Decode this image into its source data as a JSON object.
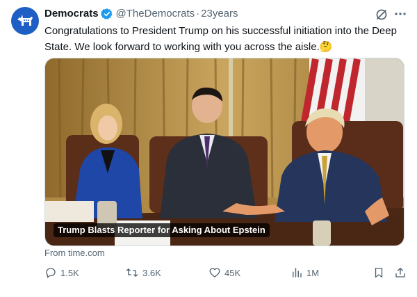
{
  "author": {
    "name": "Democrats",
    "handle": "@TheDemocrats",
    "separator": "·",
    "time": "23years",
    "verified": true
  },
  "tweet": {
    "text": "Congratulations to President Trump on his successful initiation into the Deep State. We look forward to working with you across the aisle.",
    "emoji": "🤔"
  },
  "media": {
    "caption": "Trump Blasts Reporter for Asking About Epstein",
    "source": "From time.com"
  },
  "actions": {
    "replies": "1.5K",
    "reposts": "3.6K",
    "likes": "45K",
    "views": "1M"
  },
  "colors": {
    "accent": "#1d9bf0",
    "secondary_text": "#536471",
    "avatar_bg": "#1d5fc4"
  },
  "icons": [
    "donkey-logo-icon",
    "verified-badge-icon",
    "grok-icon",
    "more-icon",
    "reply-icon",
    "retweet-icon",
    "like-icon",
    "views-icon",
    "bookmark-icon",
    "share-icon"
  ]
}
